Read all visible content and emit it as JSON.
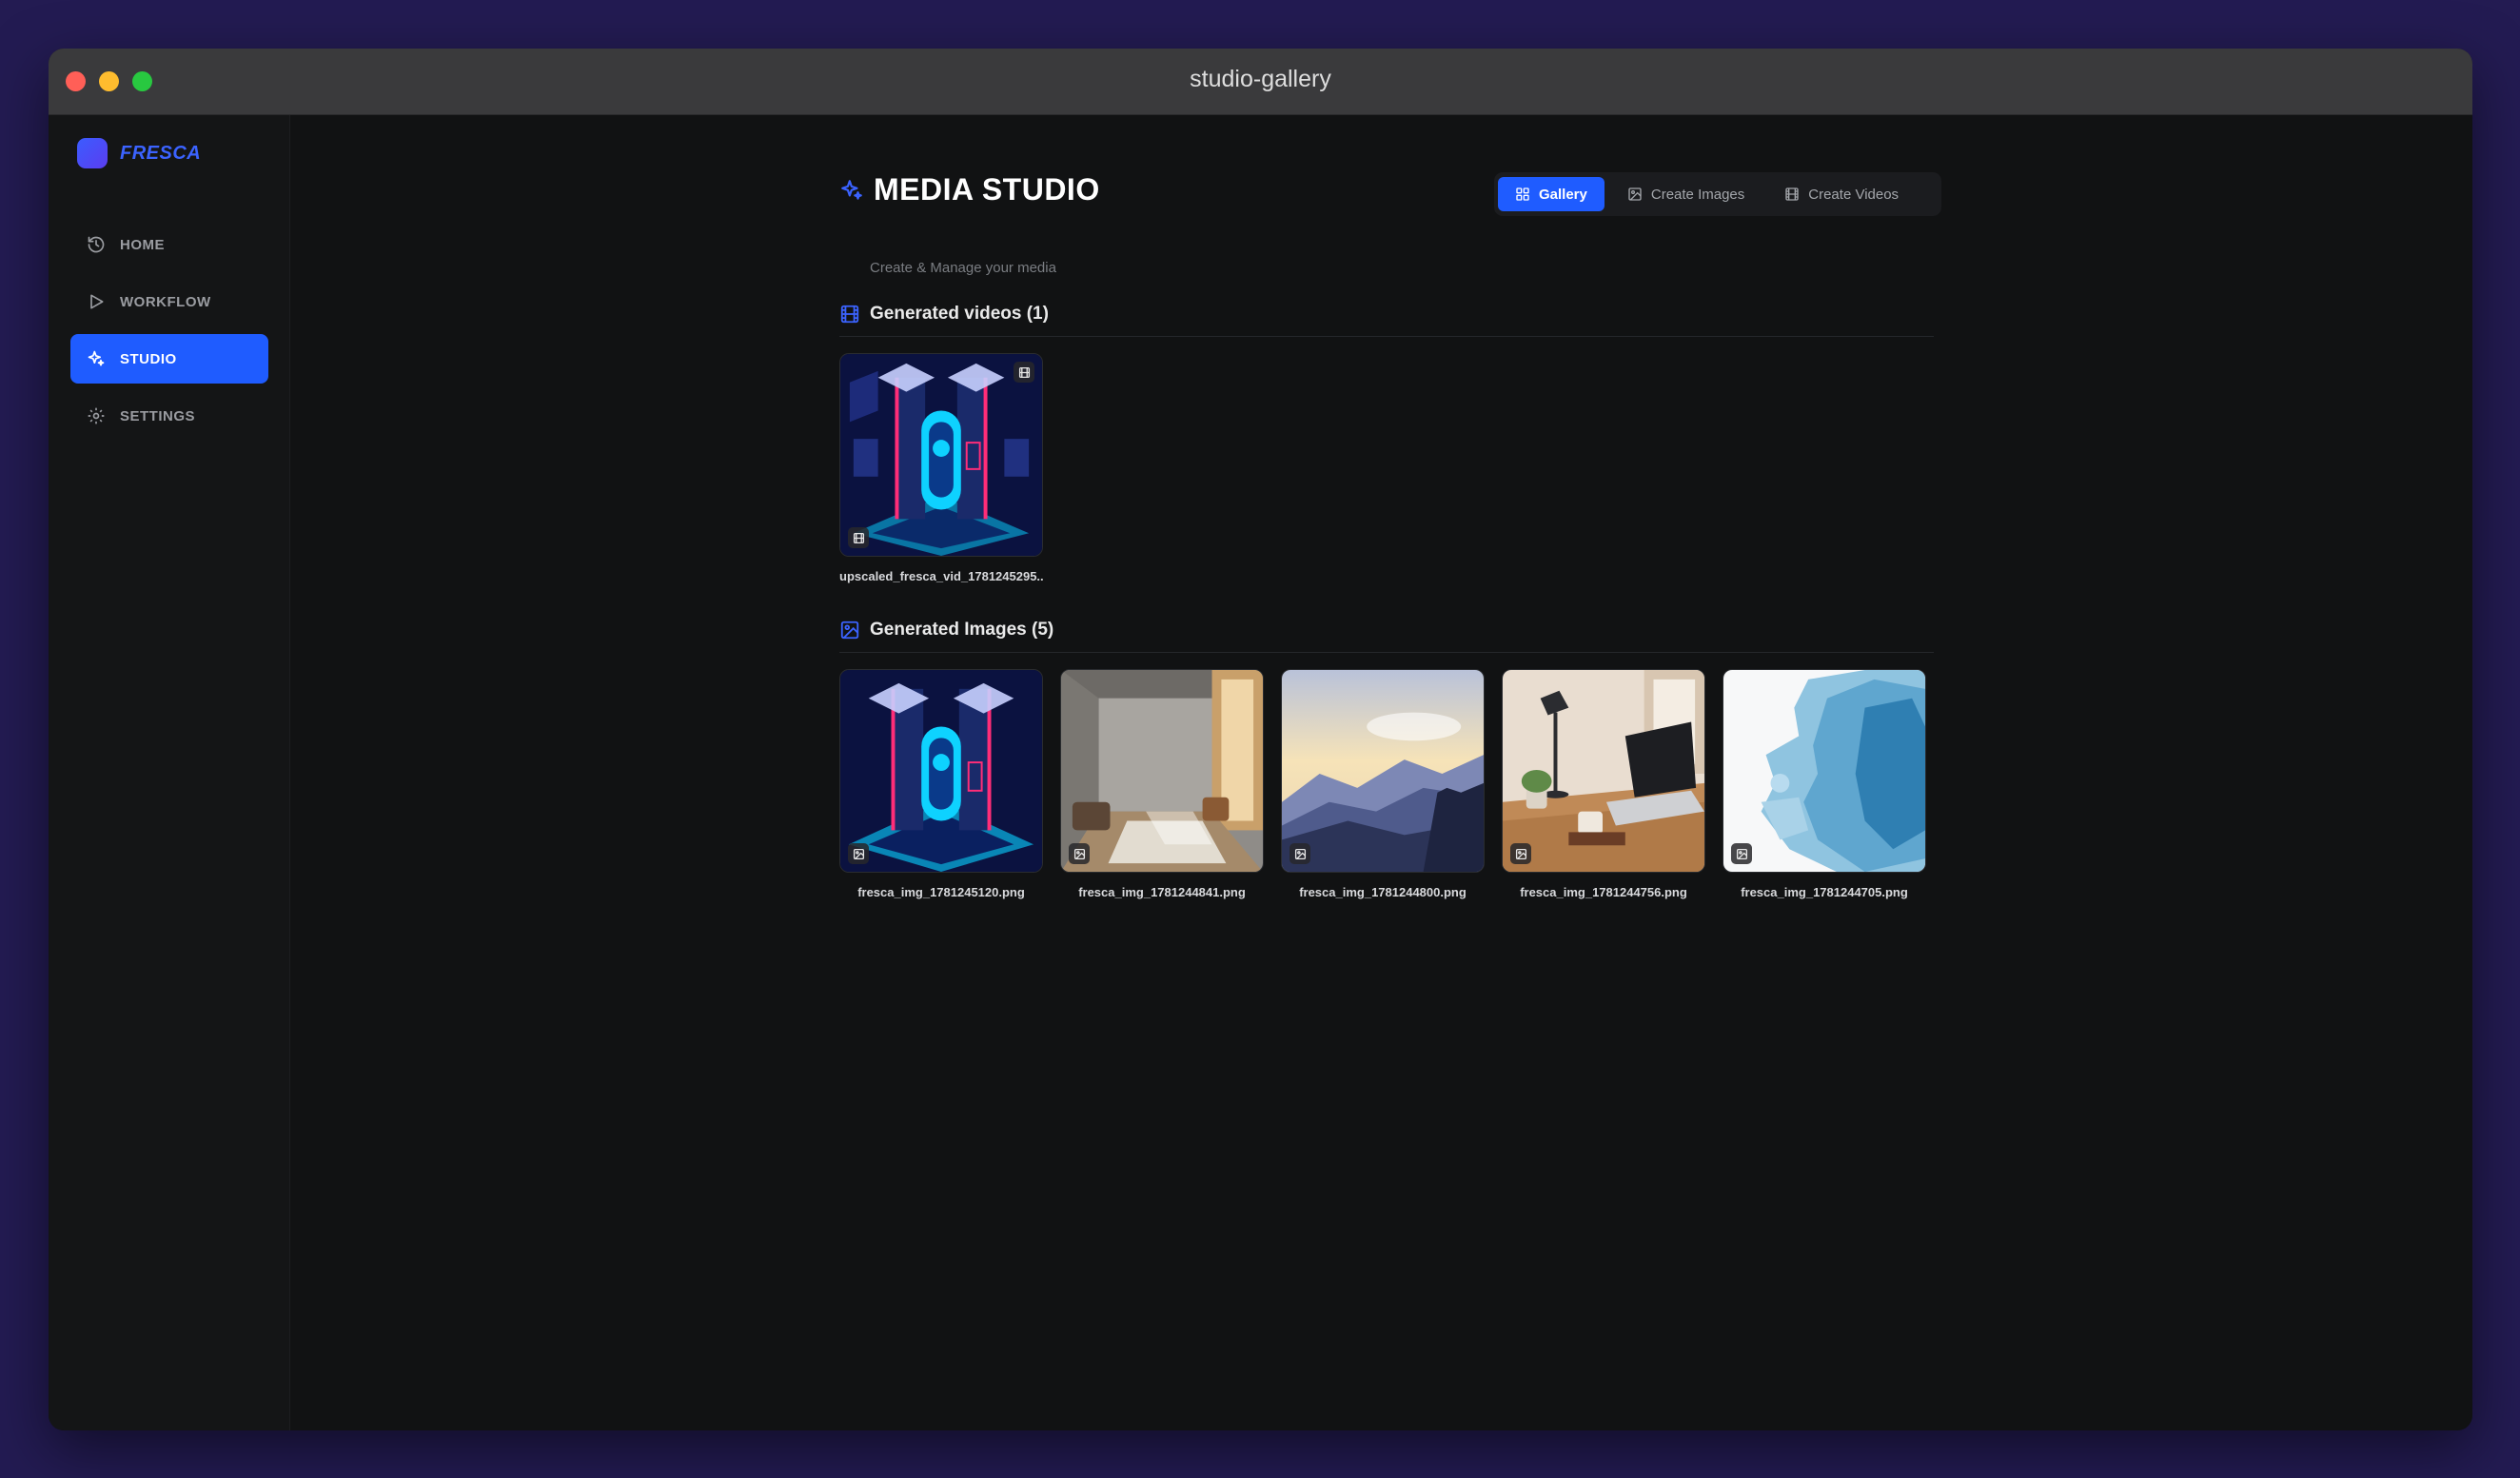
{
  "window": {
    "title": "studio-gallery"
  },
  "sidebar": {
    "brand": "FRESCA",
    "items": [
      {
        "label": "HOME",
        "icon": "history-icon"
      },
      {
        "label": "WORKFLOW",
        "icon": "play-icon"
      },
      {
        "label": "STUDIO",
        "icon": "sparkles-icon",
        "active": true
      },
      {
        "label": "SETTINGS",
        "icon": "gear-icon"
      }
    ]
  },
  "header": {
    "title": "MEDIA STUDIO",
    "subtitle": "Create & Manage your media"
  },
  "tabs": [
    {
      "label": "Gallery",
      "icon": "grid-icon",
      "active": true
    },
    {
      "label": "Create Images",
      "icon": "image-icon"
    },
    {
      "label": "Create Videos",
      "icon": "film-icon"
    }
  ],
  "videos": {
    "title": "Generated videos (1)",
    "items": [
      {
        "name": "upscaled_fresca_vid_1781245295...."
      }
    ]
  },
  "images": {
    "title": "Generated Images (5)",
    "items": [
      {
        "name": "fresca_img_1781245120.png"
      },
      {
        "name": "fresca_img_1781244841.png"
      },
      {
        "name": "fresca_img_1781244800.png"
      },
      {
        "name": "fresca_img_1781244756.png"
      },
      {
        "name": "fresca_img_1781244705.png"
      }
    ]
  },
  "colors": {
    "accent": "#1f5cff",
    "background": "#111213",
    "desktop": "#231b52"
  }
}
